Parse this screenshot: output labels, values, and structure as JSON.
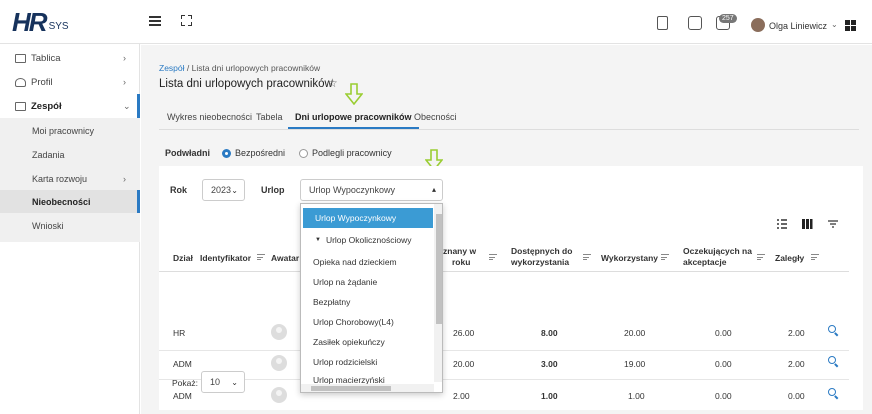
{
  "app": {
    "logo_main": "HR",
    "logo_sub": "SYS"
  },
  "header": {
    "notifications_count": "257",
    "user_name": "Olga Liniewicz"
  },
  "sidebar": {
    "items": [
      {
        "label": "Tablica"
      },
      {
        "label": "Profil"
      },
      {
        "label": "Zespół"
      }
    ],
    "sub_items": [
      {
        "label": "Moi pracownicy"
      },
      {
        "label": "Zadania"
      },
      {
        "label": "Karta rozwoju"
      },
      {
        "label": "Nieobecności"
      },
      {
        "label": "Wnioski"
      }
    ]
  },
  "breadcrumb": {
    "link": "Zespół",
    "current": " / Lista dni urlopowych pracowników"
  },
  "page_title": "Lista dni urlopowych pracowników",
  "tabs": [
    {
      "label": "Wykres nieobecności"
    },
    {
      "label": "Tabela"
    },
    {
      "label": "Dni urlopowe pracowników"
    },
    {
      "label": "Obecności"
    }
  ],
  "filter": {
    "label": "Podwładni",
    "option1": "Bezpośredni",
    "option2": "Podlegli pracownicy"
  },
  "form": {
    "year_label": "Rok",
    "year_value": "2023",
    "leave_label": "Urlop",
    "leave_value": "Urlop Wypoczynkowy"
  },
  "table": {
    "headers": {
      "dzial": "Dział",
      "identyfikator": "Identyfikator",
      "awatar": "Awatar",
      "przyznany_1": "znany w",
      "przyznany_2": "roku",
      "dostepnych_1": "Dostępnych do",
      "dostepnych_2": "wykorzystania",
      "wykorzystany": "Wykorzystany",
      "oczekujacych_1": "Oczekujących na",
      "oczekujacych_2": "akceptacje",
      "zalegly": "Zaległy"
    },
    "rows": [
      {
        "dzial": "HR",
        "przyznany": "26.00",
        "dostepnych": "8.00",
        "wykorzystany": "20.00",
        "oczekujacych": "0.00",
        "zalegly": "2.00"
      },
      {
        "dzial": "ADM",
        "przyznany": "20.00",
        "dostepnych": "3.00",
        "wykorzystany": "19.00",
        "oczekujacych": "0.00",
        "zalegly": "2.00"
      },
      {
        "dzial": "ADM",
        "przyznany": "2.00",
        "dostepnych": "1.00",
        "wykorzystany": "1.00",
        "oczekujacych": "0.00",
        "zalegly": "0.00"
      }
    ]
  },
  "pagination": {
    "label": "Pokaż:",
    "value": "10"
  },
  "dropdown": {
    "items": [
      "Urlop Wypoczynkowy",
      "Urlop Okolicznościowy",
      "Opieka nad dzieckiem",
      "Urlop na żądanie",
      "Bezpłatny",
      "Urlop Chorobowy(L4)",
      "Zasiłek opiekuńczy",
      "Urlop rodzicielski",
      "Urlop macierzyński"
    ]
  },
  "colors": {
    "accent": "#2a7ac3",
    "selected": "#3b9bd4",
    "arrow": "#9acd32"
  }
}
